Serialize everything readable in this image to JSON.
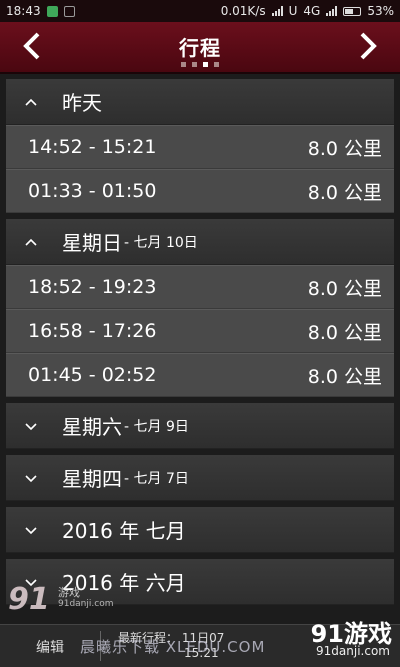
{
  "status_bar": {
    "time": "18:43",
    "net_speed": "0.01K/s",
    "carrier_u": "U",
    "network": "4G",
    "battery": "53%"
  },
  "header": {
    "title": "行程",
    "back_icon": "chevron-left-icon",
    "forward_icon": "chevron-right-icon",
    "page_dots_count": 4,
    "page_dots_active": 3,
    "bg_color": "#5c0c17"
  },
  "groups": [
    {
      "title": "昨天",
      "subtitle": "",
      "expanded": true,
      "trips": [
        {
          "time": "14:52 - 15:21",
          "distance": "8.0 公里"
        },
        {
          "time": "01:33 - 01:50",
          "distance": "8.0 公里"
        }
      ]
    },
    {
      "title": "星期日",
      "subtitle": "- 七月 10日",
      "expanded": true,
      "trips": [
        {
          "time": "18:52 - 19:23",
          "distance": "8.0 公里"
        },
        {
          "time": "16:58 - 17:26",
          "distance": "8.0 公里"
        },
        {
          "time": "01:45 - 02:52",
          "distance": "8.0 公里"
        }
      ]
    },
    {
      "title": "星期六",
      "subtitle": "- 七月 9日",
      "expanded": false,
      "trips": []
    },
    {
      "title": "星期四",
      "subtitle": "- 七月 7日",
      "expanded": false,
      "trips": []
    },
    {
      "title": "2016 年 七月",
      "subtitle": "",
      "expanded": false,
      "trips": []
    },
    {
      "title": "2016 年 六月",
      "subtitle": "",
      "expanded": false,
      "trips": []
    }
  ],
  "bottom_bar": {
    "edit_label": "编辑",
    "latest_label": "最新行程：",
    "latest_date": "11日07",
    "latest_time": "15:21"
  },
  "watermarks": {
    "left_logo": "91",
    "left_small": "游戏",
    "left_url": "91danji.com",
    "middle": "晨曦乐下载 XLEDU.COM",
    "right_brand": "91游戏",
    "right_url": "91danji.com"
  }
}
